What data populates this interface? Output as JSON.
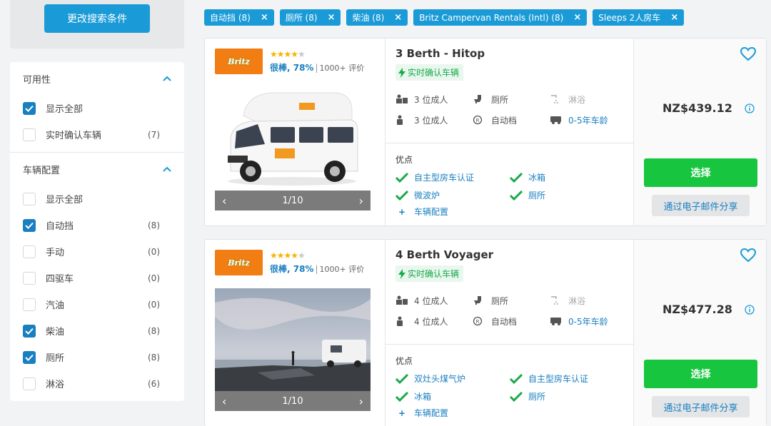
{
  "sidebar": {
    "modify_label": "更改搜索条件",
    "sections": [
      {
        "title": "可用性",
        "items": [
          {
            "label": "显示全部",
            "checked": true,
            "count": ""
          },
          {
            "label": "实时确认车辆",
            "checked": false,
            "count": "(7)"
          }
        ]
      },
      {
        "title": "车辆配置",
        "items": [
          {
            "label": "显示全部",
            "checked": false,
            "count": ""
          },
          {
            "label": "自动挡",
            "checked": true,
            "count": "(8)"
          },
          {
            "label": "手动",
            "checked": false,
            "count": "(0)"
          },
          {
            "label": "四驱车",
            "checked": false,
            "count": "(0)"
          },
          {
            "label": "汽油",
            "checked": false,
            "count": "(0)"
          },
          {
            "label": "柴油",
            "checked": true,
            "count": "(8)"
          },
          {
            "label": "厕所",
            "checked": true,
            "count": "(8)"
          },
          {
            "label": "淋浴",
            "checked": false,
            "count": "(6)"
          }
        ]
      }
    ]
  },
  "chips": [
    {
      "label": "自动挡 (8)"
    },
    {
      "label": "厕所 (8)"
    },
    {
      "label": "柴油 (8)"
    },
    {
      "label": "Britz Campervan Rentals (Intl) (8)"
    },
    {
      "label": "Sleeps 2人房车"
    }
  ],
  "results": [
    {
      "logo_text": "Britz",
      "rating_stars": 4.5,
      "rating_label": "很棒, 78%",
      "reviews": "1000+ 评价",
      "pager": "1/10",
      "name": "3 Berth - Hitop",
      "instant_label": "实时确认车辆",
      "specs": {
        "adults": "3 位成人",
        "toilet": "厕所",
        "shower": "淋浴",
        "adults2": "3 位成人",
        "transmission": "自动档",
        "age": "0-5年车龄"
      },
      "pros_title": "优点",
      "pros": [
        "自主型房车认证",
        "冰箱",
        "微波炉",
        "厕所"
      ],
      "more_label": "车辆配置",
      "price": "NZ$439.12",
      "select_label": "选择",
      "share_label": "通过电子邮件分享"
    },
    {
      "logo_text": "Britz",
      "rating_stars": 4.5,
      "rating_label": "很棒, 78%",
      "reviews": "1000+ 评价",
      "pager": "1/10",
      "name": "4 Berth Voyager",
      "instant_label": "实时确认车辆",
      "specs": {
        "adults": "4 位成人",
        "toilet": "厕所",
        "shower": "淋浴",
        "adults2": "4 位成人",
        "transmission": "自动档",
        "age": "0-5年车龄"
      },
      "pros_title": "优点",
      "pros": [
        "双灶头煤气炉",
        "自主型房车认证",
        "冰箱",
        "厕所"
      ],
      "more_label": "车辆配置",
      "price": "NZ$477.28",
      "select_label": "选择",
      "share_label": "通过电子邮件分享"
    }
  ],
  "colors": {
    "accent_blue": "#1a9bd7",
    "link_blue": "#1a7fc0",
    "select_green": "#17c63e",
    "logo_orange": "#f27d12"
  },
  "icons": [
    "chevron-up-icon",
    "checkmark-icon",
    "close-icon",
    "heart-icon",
    "info-icon",
    "bolt-icon",
    "seat-icon",
    "toilet-icon",
    "shower-icon",
    "person-icon",
    "transmission-icon",
    "camper-icon",
    "arrow-left-icon",
    "arrow-right-icon",
    "plus-icon"
  ]
}
